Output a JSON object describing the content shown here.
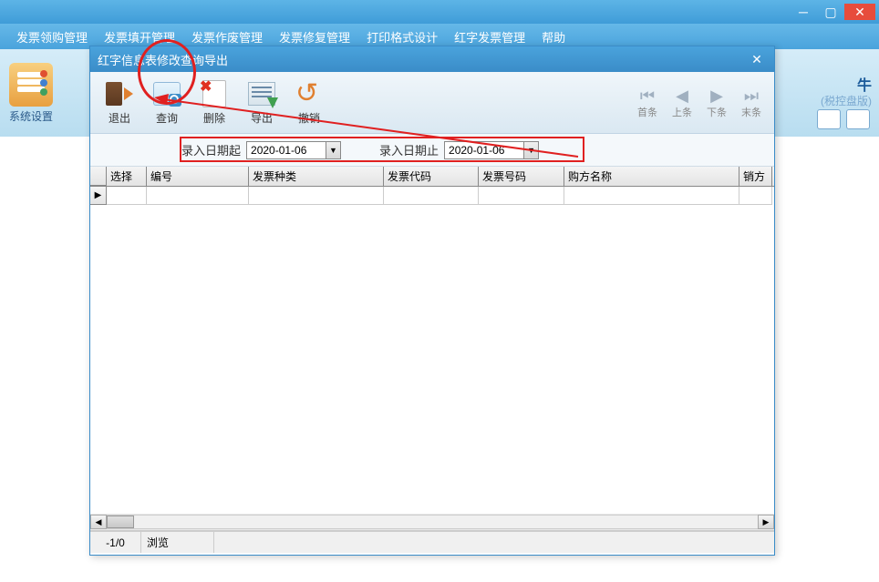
{
  "outer": {
    "menus": [
      "发票领购管理",
      "发票填开管理",
      "发票作废管理",
      "发票修复管理",
      "打印格式设计",
      "红字发票管理",
      "帮助"
    ],
    "tool_label": "系统设置",
    "right_label_suffix": "牛",
    "right_sub": "(税控盘版)"
  },
  "dialog": {
    "title": "红字信息表修改查询导出",
    "tools": {
      "exit": "退出",
      "query": "查询",
      "delete": "删除",
      "export": "导出",
      "undo": "撤销"
    },
    "nav": {
      "first": "首条",
      "prev": "上条",
      "next": "下条",
      "last": "末条"
    },
    "filters": {
      "date_from_label": "录入日期起",
      "date_from_value": "2020-01-06",
      "date_to_label": "录入日期止",
      "date_to_value": "2020-01-06"
    },
    "columns": {
      "select": "选择",
      "number": "编号",
      "type": "发票种类",
      "code": "发票代码",
      "inv_no": "发票号码",
      "buyer": "购方名称",
      "seller": "销方"
    },
    "row_marker": "▶",
    "status": {
      "position": "-1/0",
      "mode": "浏览"
    }
  }
}
